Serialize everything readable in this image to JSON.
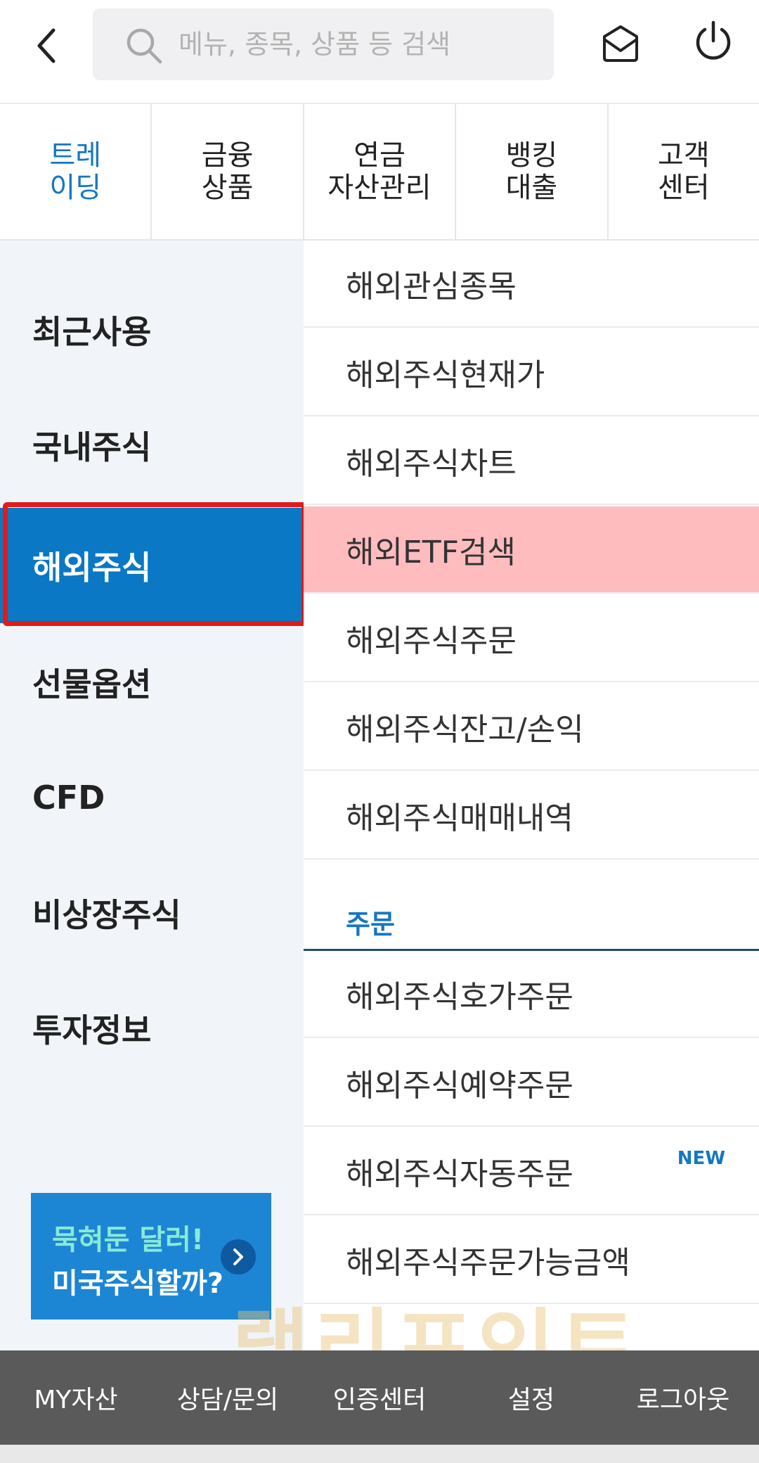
{
  "search": {
    "placeholder": "메뉴, 종목, 상품 등 검색"
  },
  "categories": [
    {
      "label": "트레\n이딩",
      "active": true
    },
    {
      "label": "금융\n상품"
    },
    {
      "label": "연금\n자산관리"
    },
    {
      "label": "뱅킹\n대출"
    },
    {
      "label": "고객\n센터"
    }
  ],
  "sidebar": {
    "items": [
      {
        "label": "최근사용"
      },
      {
        "label": "국내주식"
      },
      {
        "label": "해외주식",
        "active": true
      },
      {
        "label": "선물옵션"
      },
      {
        "label": "CFD"
      },
      {
        "label": "비상장주식"
      },
      {
        "label": "투자정보"
      }
    ],
    "banner": {
      "line1": "묵혀둔 달러!",
      "line2": "미국주식할까?"
    }
  },
  "submenu": {
    "items": [
      {
        "label": "해외관심종목"
      },
      {
        "label": "해외주식현재가"
      },
      {
        "label": "해외주식차트"
      },
      {
        "label": "해외ETF검색",
        "highlighted": true
      },
      {
        "label": "해외주식주문"
      },
      {
        "label": "해외주식잔고/손익"
      },
      {
        "label": "해외주식매매내역"
      }
    ],
    "section_title": "주문",
    "order_items": [
      {
        "label": "해외주식호가주문"
      },
      {
        "label": "해외주식예약주문"
      },
      {
        "label": "해외주식자동주문",
        "badge": "NEW"
      },
      {
        "label": "해외주식주문가능금액"
      }
    ]
  },
  "bottom_bar": {
    "items": [
      "MY자산",
      "상담/문의",
      "인증센터",
      "설정",
      "로그아웃"
    ]
  },
  "watermark": "랠리포인트",
  "colors": {
    "accent": "#1577c2",
    "active_bg": "#0a78c4",
    "highlight_bg": "#ffbcbf",
    "highlight_border": "#e11a1a",
    "bottom_bar": "#5a5a5a"
  }
}
